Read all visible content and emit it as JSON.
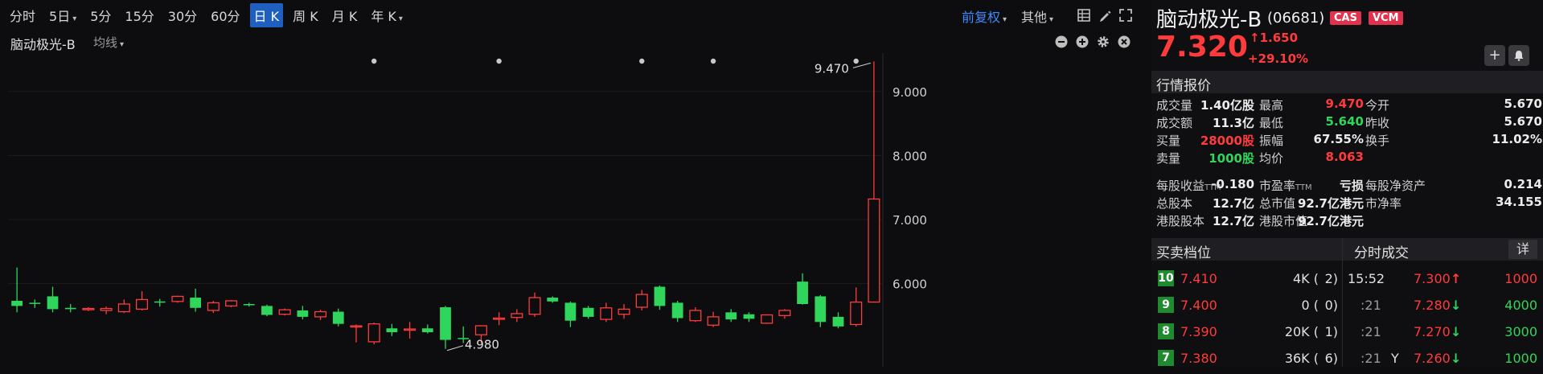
{
  "toolbar": {
    "periods": [
      {
        "label": "分时"
      },
      {
        "label": "5日",
        "chevron": "▾"
      },
      {
        "label": "5分"
      },
      {
        "label": "15分"
      },
      {
        "label": "30分"
      },
      {
        "label": "60分"
      },
      {
        "label": "日 K",
        "active": true
      },
      {
        "label": "周 K"
      },
      {
        "label": "月 K"
      },
      {
        "label": "年 K",
        "chevron": "▾"
      }
    ],
    "adjust_label": "前复权",
    "other_label": "其他",
    "chevron": "▾",
    "tools": [
      "grid-icon",
      "pencil-icon",
      "expand-icon"
    ]
  },
  "subbar": {
    "stock_name": "脑动极光-B",
    "indicator_label": "均线",
    "chevron": "▾",
    "icons": [
      "minus-icon",
      "plus-icon",
      "gear-icon",
      "close-icon"
    ]
  },
  "chart_data": {
    "type": "candlestick",
    "ylim": [
      4.7,
      9.6
    ],
    "yticks": [
      "9.000",
      "8.000",
      "7.000",
      "6.000"
    ],
    "ytick_values": [
      9.0,
      8.0,
      7.0,
      6.0
    ],
    "up_color": "#ff3b3b",
    "down_color": "#2fd65b",
    "annotations": [
      {
        "text": "9.470",
        "value": 9.47
      },
      {
        "text": "4.980",
        "value": 4.98
      }
    ],
    "candles": [
      {
        "o": 5.73,
        "h": 6.25,
        "l": 5.55,
        "c": 5.65
      },
      {
        "o": 5.7,
        "h": 5.75,
        "l": 5.62,
        "c": 5.69
      },
      {
        "o": 5.8,
        "h": 5.95,
        "l": 5.55,
        "c": 5.6
      },
      {
        "o": 5.62,
        "h": 5.68,
        "l": 5.55,
        "c": 5.6
      },
      {
        "o": 5.6,
        "h": 5.63,
        "l": 5.57,
        "c": 5.61
      },
      {
        "o": 5.58,
        "h": 5.64,
        "l": 5.52,
        "c": 5.61
      },
      {
        "o": 5.56,
        "h": 5.75,
        "l": 5.54,
        "c": 5.68
      },
      {
        "o": 5.6,
        "h": 5.88,
        "l": 5.58,
        "c": 5.75
      },
      {
        "o": 5.72,
        "h": 5.76,
        "l": 5.64,
        "c": 5.71
      },
      {
        "o": 5.72,
        "h": 5.81,
        "l": 5.7,
        "c": 5.8
      },
      {
        "o": 5.78,
        "h": 5.92,
        "l": 5.56,
        "c": 5.62
      },
      {
        "o": 5.58,
        "h": 5.73,
        "l": 5.54,
        "c": 5.7
      },
      {
        "o": 5.65,
        "h": 5.74,
        "l": 5.63,
        "c": 5.73
      },
      {
        "o": 5.68,
        "h": 5.7,
        "l": 5.64,
        "c": 5.67
      },
      {
        "o": 5.65,
        "h": 5.67,
        "l": 5.49,
        "c": 5.51
      },
      {
        "o": 5.52,
        "h": 5.61,
        "l": 5.5,
        "c": 5.59
      },
      {
        "o": 5.58,
        "h": 5.65,
        "l": 5.44,
        "c": 5.48
      },
      {
        "o": 5.48,
        "h": 5.59,
        "l": 5.43,
        "c": 5.56
      },
      {
        "o": 5.56,
        "h": 5.61,
        "l": 5.33,
        "c": 5.37
      },
      {
        "o": 5.34,
        "h": 5.36,
        "l": 5.08,
        "c": 5.34
      },
      {
        "o": 5.09,
        "h": 5.39,
        "l": 5.05,
        "c": 5.37
      },
      {
        "o": 5.3,
        "h": 5.37,
        "l": 5.18,
        "c": 5.24
      },
      {
        "o": 5.29,
        "h": 5.4,
        "l": 5.14,
        "c": 5.29
      },
      {
        "o": 5.3,
        "h": 5.36,
        "l": 5.22,
        "c": 5.24
      },
      {
        "o": 5.63,
        "h": 5.65,
        "l": 4.98,
        "c": 5.12
      },
      {
        "o": 5.15,
        "h": 5.33,
        "l": 5.07,
        "c": 5.14
      },
      {
        "o": 5.2,
        "h": 5.35,
        "l": 5.07,
        "c": 5.34
      },
      {
        "o": 5.45,
        "h": 5.55,
        "l": 5.35,
        "c": 5.46
      },
      {
        "o": 5.47,
        "h": 5.6,
        "l": 5.4,
        "c": 5.53
      },
      {
        "o": 5.52,
        "h": 5.86,
        "l": 5.48,
        "c": 5.78
      },
      {
        "o": 5.78,
        "h": 5.8,
        "l": 5.7,
        "c": 5.72
      },
      {
        "o": 5.7,
        "h": 5.72,
        "l": 5.32,
        "c": 5.42
      },
      {
        "o": 5.62,
        "h": 5.65,
        "l": 5.45,
        "c": 5.48
      },
      {
        "o": 5.44,
        "h": 5.7,
        "l": 5.4,
        "c": 5.62
      },
      {
        "o": 5.52,
        "h": 5.68,
        "l": 5.45,
        "c": 5.6
      },
      {
        "o": 5.63,
        "h": 5.9,
        "l": 5.58,
        "c": 5.83
      },
      {
        "o": 5.95,
        "h": 5.97,
        "l": 5.59,
        "c": 5.65
      },
      {
        "o": 5.7,
        "h": 5.73,
        "l": 5.4,
        "c": 5.46
      },
      {
        "o": 5.42,
        "h": 5.63,
        "l": 5.4,
        "c": 5.58
      },
      {
        "o": 5.35,
        "h": 5.56,
        "l": 5.32,
        "c": 5.48
      },
      {
        "o": 5.55,
        "h": 5.6,
        "l": 5.4,
        "c": 5.44
      },
      {
        "o": 5.52,
        "h": 5.55,
        "l": 5.4,
        "c": 5.45
      },
      {
        "o": 5.38,
        "h": 5.52,
        "l": 5.37,
        "c": 5.51
      },
      {
        "o": 5.5,
        "h": 5.6,
        "l": 5.45,
        "c": 5.58
      },
      {
        "o": 6.03,
        "h": 6.16,
        "l": 5.67,
        "c": 5.68
      },
      {
        "o": 5.8,
        "h": 5.82,
        "l": 5.32,
        "c": 5.4
      },
      {
        "o": 5.48,
        "h": 5.55,
        "l": 5.3,
        "c": 5.33
      },
      {
        "o": 5.36,
        "h": 5.94,
        "l": 5.33,
        "c": 5.71
      },
      {
        "o": 5.71,
        "h": 9.47,
        "l": 5.71,
        "c": 7.32
      }
    ],
    "markers": [
      20,
      27,
      35,
      39,
      47
    ]
  },
  "panel": {
    "name": "脑动极光-B",
    "code": "(06681)",
    "badges": [
      "CAS",
      "VCM"
    ],
    "price": "7.320",
    "change": "↑1.650",
    "change_pct": "+29.10%",
    "buttons": [
      "+",
      "🔔"
    ],
    "quote_header": "行情报价",
    "quote_rows": [
      [
        [
          "成交量",
          "1.40亿股",
          ""
        ],
        [
          "最高",
          "9.470",
          "red"
        ],
        [
          "今开",
          "5.670",
          ""
        ]
      ],
      [
        [
          "成交额",
          "11.3亿",
          ""
        ],
        [
          "最低",
          "5.640",
          "green"
        ],
        [
          "昨收",
          "5.670",
          ""
        ]
      ],
      [
        [
          "买量",
          "28000股",
          "red"
        ],
        [
          "振幅",
          "67.55%",
          ""
        ],
        [
          "换手",
          "11.02%",
          ""
        ]
      ],
      [
        [
          "卖量",
          "1000股",
          "green"
        ],
        [
          "均价",
          "8.063",
          "red"
        ],
        [
          "",
          "",
          " "
        ]
      ]
    ],
    "stats_rows": [
      [
        [
          "每股收益",
          "TTM",
          "-0.180"
        ],
        [
          "市盈率",
          "TTM",
          "亏损"
        ],
        [
          "每股净资产",
          "",
          "0.214"
        ]
      ],
      [
        [
          "总股本",
          "",
          "12.7亿"
        ],
        [
          "总市值",
          "",
          "92.7亿港元"
        ],
        [
          "市净率",
          "",
          "34.155"
        ]
      ],
      [
        [
          "港股股本",
          "",
          "12.7亿"
        ],
        [
          "港股市值",
          "",
          "92.7亿港元"
        ],
        [
          "",
          "",
          ""
        ]
      ]
    ],
    "book_header": "买卖档位",
    "trades_header": "分时成交",
    "detail_label": "详",
    "book": [
      {
        "level": "10",
        "price": "7.410",
        "qty": "4K (",
        "orders": "2)"
      },
      {
        "level": "9",
        "price": "7.400",
        "qty": "0 (",
        "orders": "0)"
      },
      {
        "level": "8",
        "price": "7.390",
        "qty": "20K (",
        "orders": "1)"
      },
      {
        "level": "7",
        "price": "7.380",
        "qty": "36K (",
        "orders": "6)"
      }
    ],
    "trades": [
      {
        "time": "15:52",
        "flag": "",
        "price": "7.300",
        "dir": "↑",
        "qty": "1000",
        "pclass": "red",
        "qclass": "red"
      },
      {
        "time": ":21",
        "flag": "",
        "price": "7.280",
        "dir": "↓",
        "qty": "4000",
        "pclass": "red",
        "qclass": "green"
      },
      {
        "time": ":21",
        "flag": "",
        "price": "7.270",
        "dir": "↓",
        "qty": "3000",
        "pclass": "red",
        "qclass": "green"
      },
      {
        "time": ":21",
        "flag": "Y",
        "price": "7.260",
        "dir": "↓",
        "qty": "1000",
        "pclass": "red",
        "qclass": "green"
      }
    ]
  }
}
